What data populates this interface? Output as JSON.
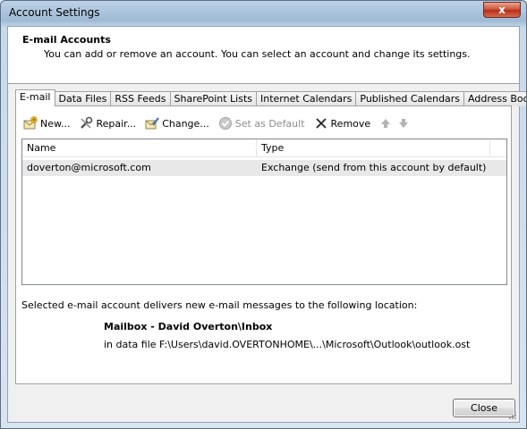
{
  "window": {
    "title": "Account Settings",
    "close_glyph": "x"
  },
  "header": {
    "title": "E-mail Accounts",
    "subtitle": "You can add or remove an account. You can select an account and change its settings."
  },
  "tabs": [
    {
      "label": "E-mail",
      "active": true
    },
    {
      "label": "Data Files",
      "active": false
    },
    {
      "label": "RSS Feeds",
      "active": false
    },
    {
      "label": "SharePoint Lists",
      "active": false
    },
    {
      "label": "Internet Calendars",
      "active": false
    },
    {
      "label": "Published Calendars",
      "active": false
    },
    {
      "label": "Address Books",
      "active": false
    }
  ],
  "toolbar": {
    "new_label": "New...",
    "repair_label": "Repair...",
    "change_label": "Change...",
    "set_default_label": "Set as Default",
    "remove_label": "Remove",
    "icons": [
      "new-account-icon",
      "repair-icon",
      "change-icon",
      "check-icon",
      "remove-x-icon",
      "arrow-up-icon",
      "arrow-down-icon"
    ]
  },
  "accounts_table": {
    "columns": [
      "Name",
      "Type"
    ],
    "rows": [
      {
        "name": "doverton@microsoft.com",
        "type": "Exchange (send from this account by default)"
      }
    ]
  },
  "delivery": {
    "description": "Selected e-mail account delivers new e-mail messages to the following location:",
    "mailbox": "Mailbox - David Overton\\Inbox",
    "data_file": "in data file F:\\Users\\david.OVERTONHOME\\...\\Microsoft\\Outlook\\outlook.ost"
  },
  "footer": {
    "close_label": "Close"
  },
  "colors": {
    "accent": "#c9d9e9",
    "close_red": "#c8442a",
    "selected_row": "#e8e8e8"
  }
}
